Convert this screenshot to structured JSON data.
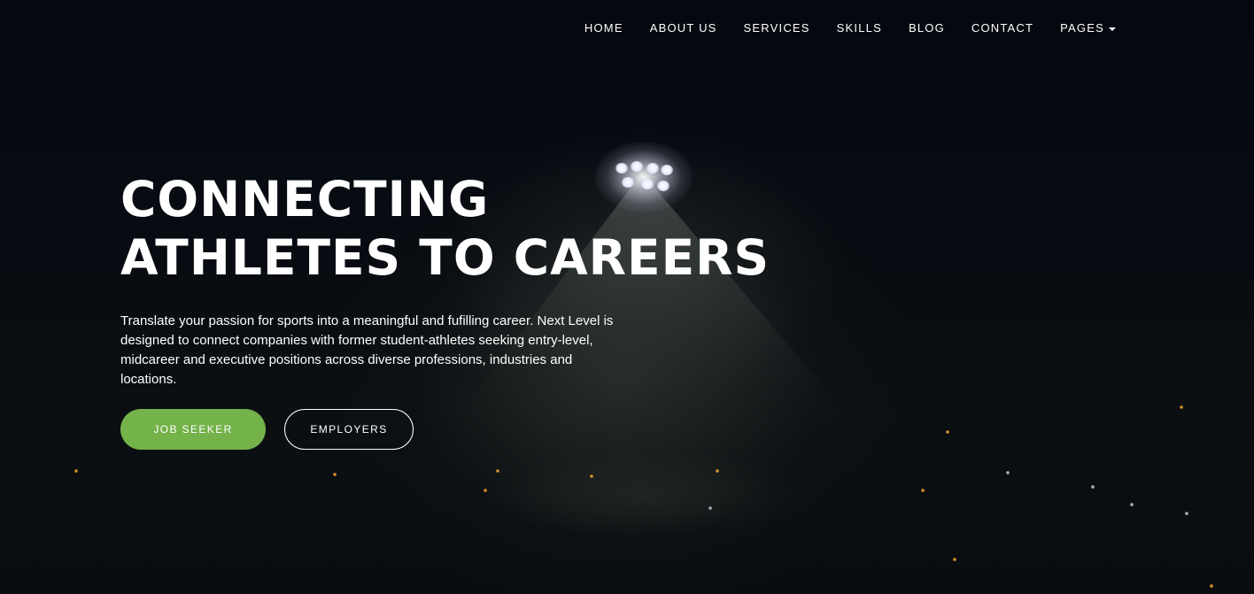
{
  "nav": {
    "items": [
      {
        "label": "HOME"
      },
      {
        "label": "ABOUT US"
      },
      {
        "label": "SERVICES"
      },
      {
        "label": "SKILLS"
      },
      {
        "label": "BLOG"
      },
      {
        "label": "CONTACT"
      },
      {
        "label": "PAGES",
        "has_dropdown": true
      }
    ]
  },
  "hero": {
    "headline_line1": "CONNECTING",
    "headline_line2": "ATHLETES TO CAREERS",
    "description": "Translate your passion for sports into a meaningful and fufilling career. Next Level is designed to connect companies with former student-athletes seeking entry-level, midcareer and executive positions across diverse professions, industries and locations.",
    "primary_button": "JOB SEEKER",
    "secondary_button": "EMPLOYERS"
  },
  "colors": {
    "accent": "#74b24a",
    "background": "#04070d",
    "text": "#ffffff"
  },
  "icons": {
    "dropdown": "caret-down-icon"
  }
}
